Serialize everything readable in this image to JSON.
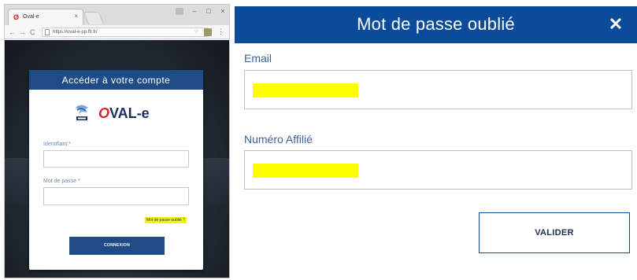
{
  "browser": {
    "tab_title": "Oval-e",
    "tab_close": "×",
    "url": "https://oval-e-pp.ffr.fr/",
    "win_minimize": "–",
    "win_maximize": "□",
    "win_close": "×",
    "nav_back": "←",
    "nav_forward": "→",
    "nav_reload": "C",
    "menu": "⋮",
    "star": "☆"
  },
  "login": {
    "header_title": "Accéder à votre compte",
    "logo_text_o": "O",
    "logo_text_rest": "VAL-e",
    "identifiant_label": "Identifiant *",
    "password_label": "Mot de passe *",
    "forgot_link": "Mot de passe oublié ?",
    "connect_button": "CONNEXION"
  },
  "modal": {
    "title": "Mot de passe oublié",
    "close_symbol": "✕",
    "email_label": "Email",
    "affilie_label": "Numéro Affilié",
    "submit_button": "VALIDER"
  },
  "colors": {
    "primary_blue": "#0b4c9a",
    "login_blue": "#1f4c86",
    "highlight_yellow": "#ffff00"
  }
}
